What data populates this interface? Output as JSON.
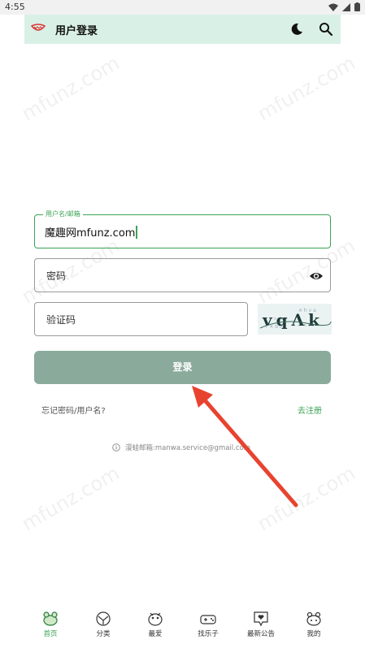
{
  "status_bar": {
    "time": "4:55"
  },
  "header": {
    "title": "用户登录",
    "logo": "mouth-logo-icon",
    "theme_icon": "moon-icon",
    "search_icon": "search-icon"
  },
  "watermark": "mfunz.com",
  "form": {
    "username": {
      "label": "用户名/邮箱",
      "value": "魔趣网mfunz.com"
    },
    "password": {
      "placeholder": "密码",
      "toggle_icon": "eye-icon"
    },
    "captcha": {
      "placeholder": "验证码",
      "image_text": "vqΛk"
    },
    "login_label": "登录",
    "forgot_label": "忘记密码/用户名?",
    "register_label": "去注册"
  },
  "contact": {
    "icon": "info-icon",
    "text": "漫蛙邮箱:manwa.service@gmail.com"
  },
  "bottom_nav": {
    "items": [
      {
        "label": "首页",
        "icon": "home-icon",
        "active": true
      },
      {
        "label": "分类",
        "icon": "category-icon",
        "active": false
      },
      {
        "label": "最爱",
        "icon": "favorite-icon",
        "active": false
      },
      {
        "label": "找乐子",
        "icon": "gamepad-icon",
        "active": false
      },
      {
        "label": "最新公告",
        "icon": "notice-icon",
        "active": false
      },
      {
        "label": "我的",
        "icon": "profile-icon",
        "active": false
      }
    ]
  },
  "colors": {
    "accent": "#3aa354",
    "header_bg": "#d9f0e6",
    "button_bg": "#8aab9b",
    "arrow": "#e8432f"
  }
}
